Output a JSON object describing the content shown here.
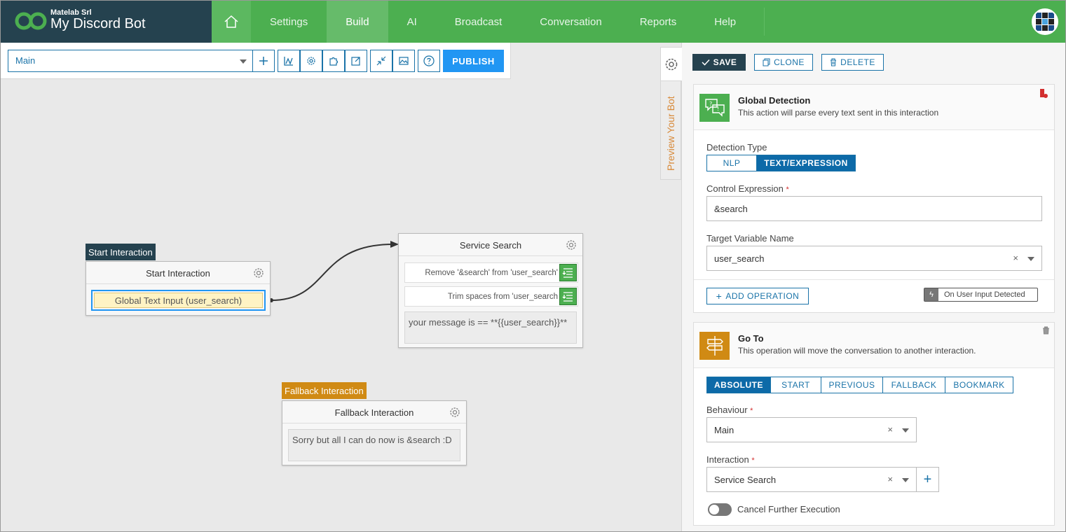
{
  "brand": {
    "company": "Matelab Srl",
    "bot_name": "My Discord Bot"
  },
  "nav": {
    "items": [
      {
        "label": "Settings"
      },
      {
        "label": "Build"
      },
      {
        "label": "AI"
      },
      {
        "label": "Broadcast"
      },
      {
        "label": "Conversation"
      },
      {
        "label": "Reports"
      },
      {
        "label": "Help"
      }
    ],
    "active": "Build"
  },
  "toolbar": {
    "flow_select": "Main",
    "publish_label": "PUBLISH"
  },
  "canvas": {
    "start_tag": "Start Interaction",
    "start_node": {
      "title": "Start Interaction",
      "item": "Global Text Input (user_search)"
    },
    "service_node": {
      "title": "Service Search",
      "ops": [
        "Remove '&search' from 'user_search'",
        "Trim spaces from 'user_search"
      ],
      "message": "your message is == **{{user_search}}**"
    },
    "fallback_tag": "Fallback Interaction",
    "fallback_node": {
      "title": "Fallback Interaction",
      "message": "Sorry but all I can do now is &search :D"
    }
  },
  "panel": {
    "preview_tab": "Preview Your Bot",
    "save_label": "SAVE",
    "clone_label": "CLONE",
    "delete_label": "DELETE",
    "global_detection": {
      "title": "Global Detection",
      "desc": "This action will parse every text sent in this interaction",
      "detection_type_label": "Detection Type",
      "detection_types": [
        "NLP",
        "TEXT/EXPRESSION"
      ],
      "detection_selected": "TEXT/EXPRESSION",
      "control_expression_label": "Control Expression",
      "control_expression_value": "&search",
      "target_variable_label": "Target Variable Name",
      "target_variable_value": "user_search",
      "add_operation_label": "ADD OPERATION",
      "event_badge": "On User Input Detected"
    },
    "goto": {
      "title": "Go To",
      "desc": "This operation will move the conversation to another interaction.",
      "modes": [
        "ABSOLUTE",
        "START",
        "PREVIOUS",
        "FALLBACK",
        "BOOKMARK"
      ],
      "mode_selected": "ABSOLUTE",
      "behaviour_label": "Behaviour",
      "behaviour_value": "Main",
      "interaction_label": "Interaction",
      "interaction_value": "Service Search",
      "cancel_label": "Cancel Further Execution"
    }
  },
  "colors": {
    "header_dark": "#25424f",
    "nav_green": "#4caf50",
    "accent_blue": "#1a73a8",
    "publish_blue": "#2196f3",
    "start_tag": "#25424f",
    "fallback_tag": "#d08a14",
    "goto_icon": "#d08a14",
    "detection_icon": "#4caf50",
    "highlight_yellow": "#fff3c4"
  }
}
